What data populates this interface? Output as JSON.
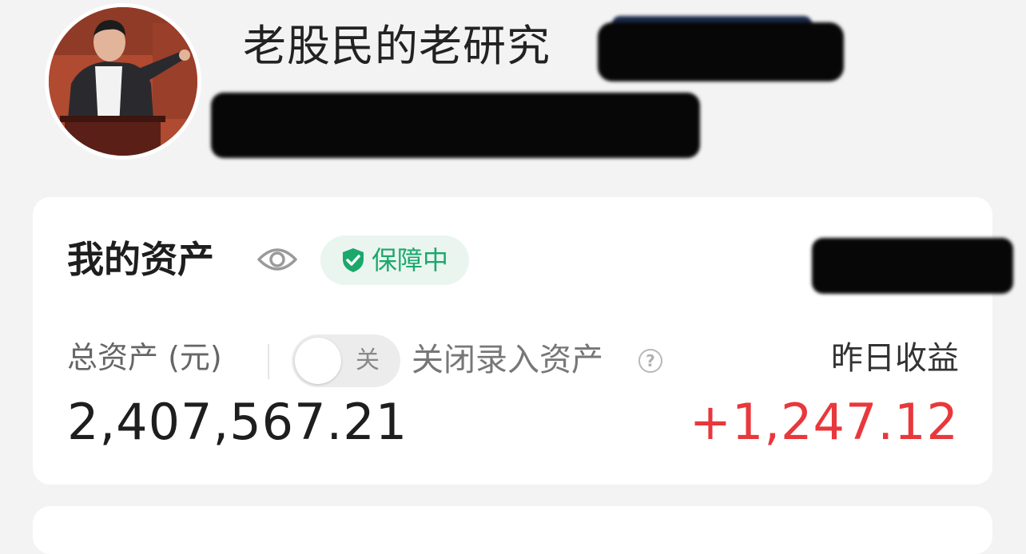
{
  "profile": {
    "username": "老股民的老研究"
  },
  "asset_card": {
    "title": "我的资产",
    "badge_label": "保障中",
    "total_label": "总资产 (元)",
    "toggle_state": "关",
    "toggle_label": "关闭录入资产",
    "help_symbol": "?",
    "total_value": "2,407,567.21",
    "yesterday_label": "昨日收益",
    "yesterday_value": "+1,247.12"
  },
  "colors": {
    "positive": "#e8383c",
    "badge_green": "#1ba86b",
    "badge_bg": "#eaf5f0",
    "background": "#f3f3f3",
    "card": "#ffffff"
  },
  "icons": {
    "eye": "eye-icon",
    "badge": "shield-check-icon",
    "help": "question-circle-icon"
  }
}
